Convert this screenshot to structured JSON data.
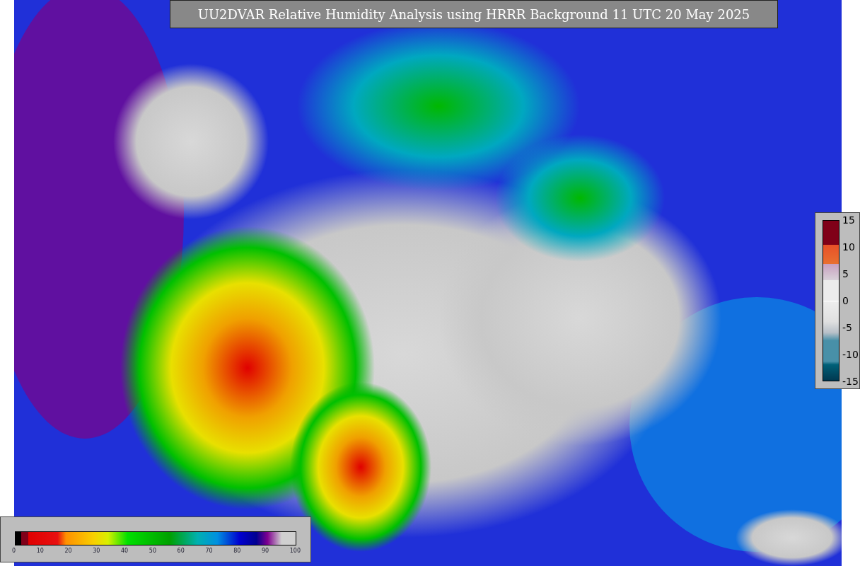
{
  "title": "UU2DVAR Relative Humidity Analysis using HRRR Background 11 UTC 20 May 2025",
  "humidity_colorbar": {
    "ticks": [
      "0",
      "10",
      "20",
      "30",
      "40",
      "50",
      "60",
      "70",
      "80",
      "90",
      "100"
    ]
  },
  "increment_colorbar": {
    "ticks": [
      "15",
      "10",
      "5",
      "0",
      "-5",
      "-10",
      "-15"
    ]
  }
}
